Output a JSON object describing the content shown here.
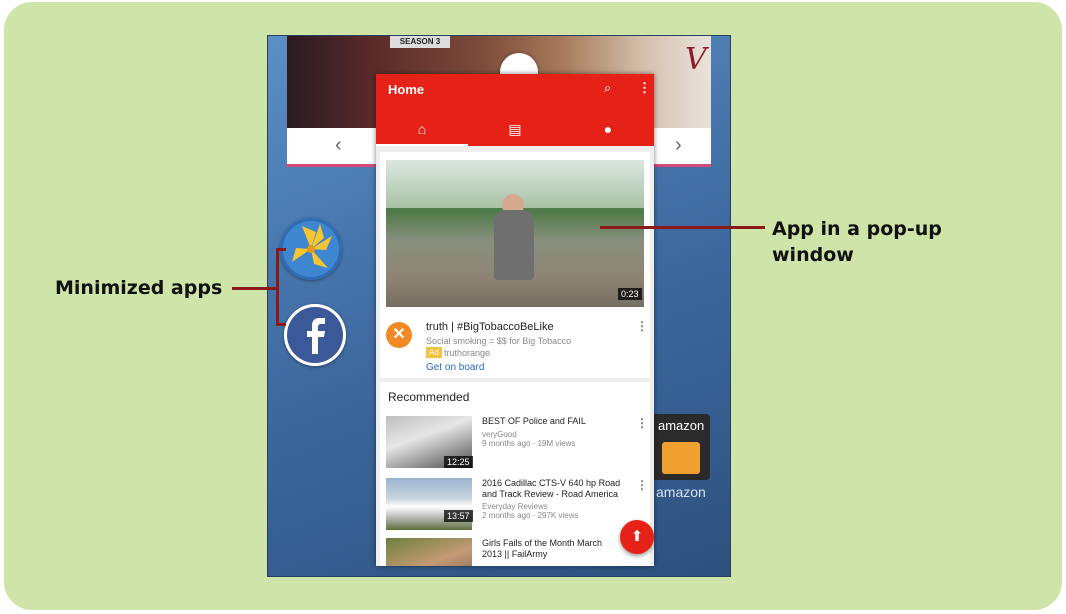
{
  "callouts": {
    "minimized_apps": "Minimized apps",
    "popup_line1": "App in a pop-up",
    "popup_line2": "window"
  },
  "background": {
    "banner_text": "SEASON 3",
    "channel_logo": "V",
    "nav_prev": "‹",
    "nav_next": "›",
    "amazon_tile_label": "amazon",
    "amazon_caption": "amazon"
  },
  "minimized_apps": [
    {
      "icon": "gallery-pinwheel-icon"
    },
    {
      "icon": "facebook-icon",
      "glyph": "f"
    }
  ],
  "popup": {
    "header_title": "Home",
    "search_icon": "⌕",
    "more_icon": "⋮",
    "tabs": [
      {
        "icon": "home-icon",
        "glyph": "⌂"
      },
      {
        "icon": "subscriptions-icon",
        "glyph": "▤"
      },
      {
        "icon": "account-icon",
        "glyph": "●"
      }
    ],
    "featured": {
      "duration": "0:23",
      "title": "truth | #BigTobaccoBeLike",
      "subtitle": "Social smoking = $$ for Big Tobacco",
      "badge": "Ad",
      "channel": "truthorange",
      "cta": "Get on board"
    },
    "section_title": "Recommended",
    "videos": [
      {
        "title": "BEST OF Police and FAIL",
        "channel": "veryGood",
        "meta": "9 months ago · 19M views",
        "duration": "12:25"
      },
      {
        "title": "2016 Cadillac CTS-V 640 hp Road and Track Review - Road America",
        "channel": "Everyday Reviews",
        "meta": "2 months ago · 297K views",
        "duration": "13:57"
      },
      {
        "title": "Girls Fails of the Month March 2013 || FailArmy",
        "channel": "",
        "meta": "",
        "duration": ""
      }
    ],
    "fab_icon": "upload-icon",
    "fab_glyph": "⬆"
  }
}
